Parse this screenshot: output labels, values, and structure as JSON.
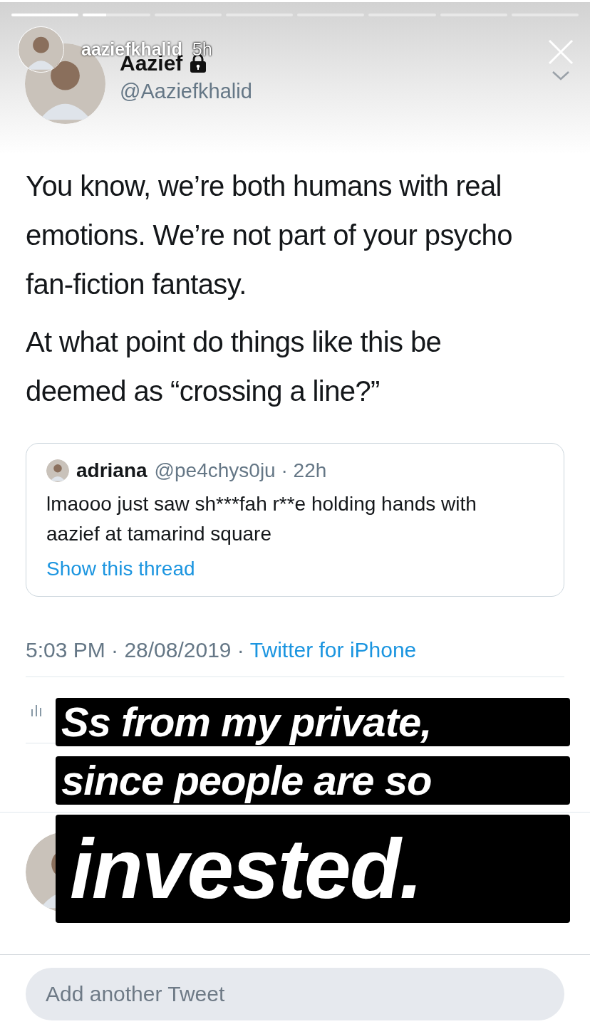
{
  "story": {
    "progress": [
      {
        "level": 1
      },
      {
        "level": 0.35
      },
      {
        "level": 0
      },
      {
        "level": 0
      },
      {
        "level": 0
      },
      {
        "level": 0
      },
      {
        "level": 0
      },
      {
        "level": 0
      }
    ],
    "username": "aaziefkhalid",
    "time": "5h"
  },
  "tweet": {
    "name": "Aazief",
    "locked": true,
    "handle": "@Aaziefkhalid",
    "paragraphs": [
      "You know, we’re both humans with real emotions. We’re not part of your psycho fan-fiction fantasy.",
      "At what point do things like this be deemed as “crossing a line?”"
    ],
    "quote": {
      "name": "adriana",
      "meta": "@pe4chys0ju · 22h",
      "text": "lmaooo just saw sh***fah r**e holding hands with aazief at tamarind square",
      "link": "Show this thread"
    },
    "meta": "5:03 PM · 28/08/2019 ·",
    "source": "Twitter for iPhone"
  },
  "caption_lines": [
    {
      "kind": "line",
      "text": "Ss from my private,"
    },
    {
      "kind": "line",
      "text": "since people are so"
    },
    {
      "kind": "emphasis",
      "text": "invested."
    }
  ],
  "composer": {
    "placeholder": "Add another Tweet"
  }
}
